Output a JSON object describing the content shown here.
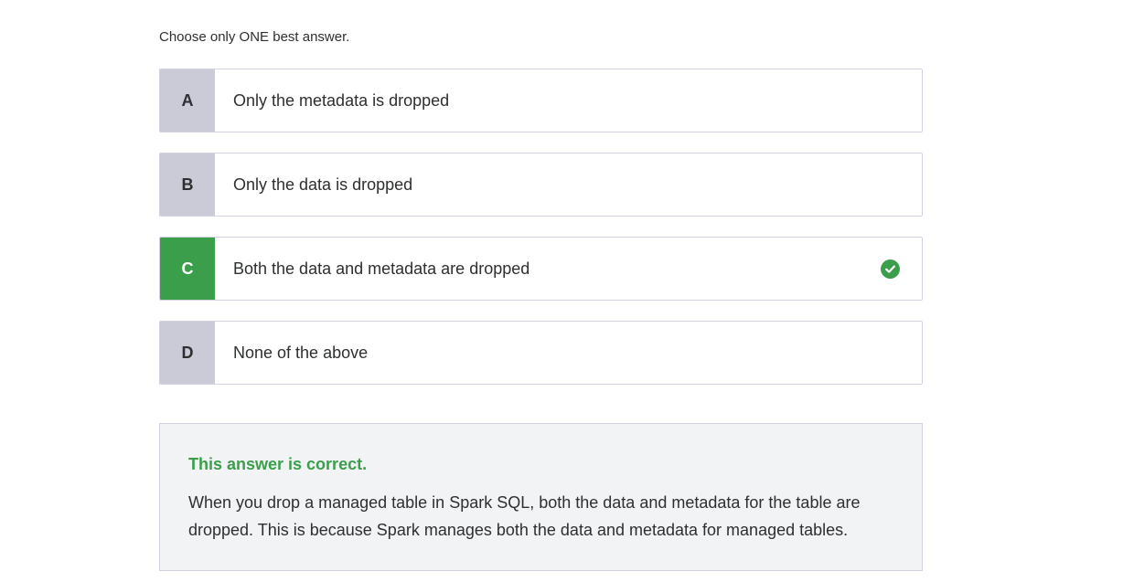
{
  "instruction": "Choose only ONE best answer.",
  "options": [
    {
      "letter": "A",
      "text": "Only the metadata is dropped",
      "correct": false
    },
    {
      "letter": "B",
      "text": "Only the data is dropped",
      "correct": false
    },
    {
      "letter": "C",
      "text": "Both the data and metadata are dropped",
      "correct": true
    },
    {
      "letter": "D",
      "text": "None of the above",
      "correct": false
    }
  ],
  "feedback": {
    "title": "This answer is correct.",
    "body": "When you drop a managed table in Spark SQL, both the data and metadata for the table are dropped. This is because Spark manages both the data and metadata for managed tables."
  },
  "icons": {
    "correct_mark": "check-circle-icon"
  },
  "colors": {
    "correct": "#3a9e4b",
    "letter_bg": "#cacbd6",
    "feedback_bg": "#f2f3f5"
  }
}
